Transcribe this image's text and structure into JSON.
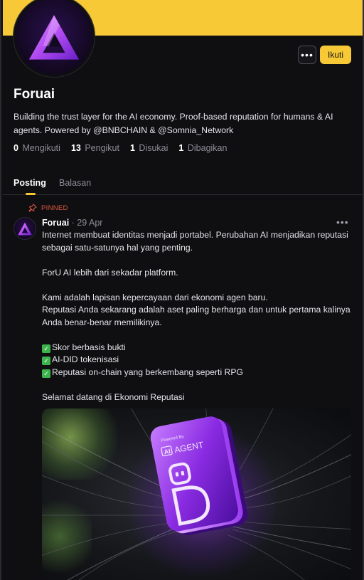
{
  "profile": {
    "name": "Foruai",
    "bio": "Building the trust layer for the AI economy. Proof-based reputation for humans & AI agents. Powered by @BNBCHAIN & @Somnia_Network",
    "follow_label": "Ikuti",
    "more_label": "•••",
    "stats": [
      {
        "value": "0",
        "label": "Mengikuti"
      },
      {
        "value": "13",
        "label": "Pengikut"
      },
      {
        "value": "1",
        "label": "Disukai"
      },
      {
        "value": "1",
        "label": "Dibagikan"
      }
    ]
  },
  "tabs": [
    {
      "label": "Posting",
      "active": true
    },
    {
      "label": "Balasan",
      "active": false
    }
  ],
  "post": {
    "pinned_label": "PINNED",
    "author": "Foruai",
    "date": " · 29 Apr",
    "more_label": "•••",
    "paragraphs": [
      "Internet membuat identitas menjadi portabel. Perubahan AI menjadikan reputasi sebagai satu-satunya hal yang penting.",
      "ForU AI lebih dari sekadar platform.",
      "Kami adalah lapisan kepercayaan dari ekonomi agen baru.",
      "Reputasi Anda sekarang adalah aset paling berharga dan untuk pertama kalinya Anda benar-benar memilikinya."
    ],
    "checklist": [
      "Skor berbasis bukti",
      "AI-DID tokenisasi",
      "Reputasi on-chain yang berkembang seperti RPG"
    ],
    "closing": "Selamat datang di Ekonomi Reputasi",
    "media": {
      "card_small_text": "Powered By",
      "card_ai": "AI",
      "card_agent": "AGENT"
    }
  },
  "colors": {
    "accent": "#f7c936",
    "pinned": "#e0573f",
    "check": "#3cb44b",
    "background": "#0f0f12"
  }
}
